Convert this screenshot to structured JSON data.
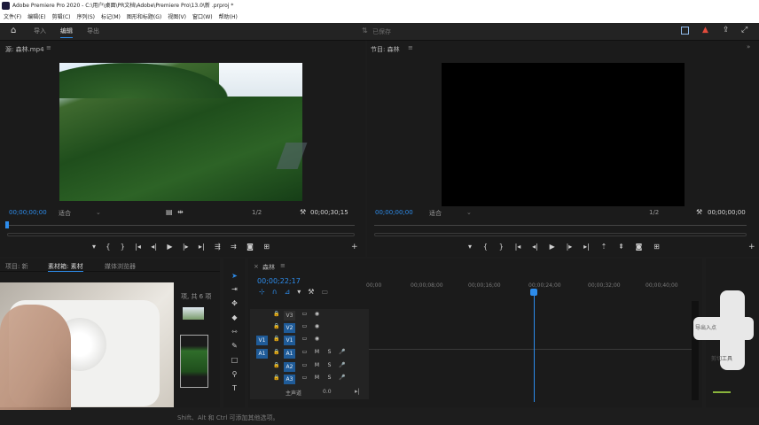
{
  "titlebar": {
    "text": "Adobe Premiere Pro 2020 - C:\\用户\\桌面\\PR文档\\Adobe\\Premiere Pro\\13.0\\新 .prproj *"
  },
  "menus": [
    "文件(F)",
    "编辑(E)",
    "剪辑(C)",
    "序列(S)",
    "标记(M)",
    "图形和标题(G)",
    "视图(V)",
    "窗口(W)",
    "帮助(H)"
  ],
  "workspace_tabs": [
    {
      "label": "导入"
    },
    {
      "label": "编辑",
      "active": true
    },
    {
      "label": "导出"
    }
  ],
  "center_status": "已保存",
  "source_monitor": {
    "title": "源: 森林.mp4",
    "timecode_left": "00;00;00;00",
    "fit": "适合",
    "resolution": "1/2",
    "timecode_right": "00;00;30;15"
  },
  "program_monitor": {
    "title": "节目: 森林",
    "timecode_left": "00;00;00;00",
    "fit": "适合",
    "resolution": "1/2",
    "timecode_right": "00;00;00;00"
  },
  "project_panel": {
    "tabs": [
      "项目: 新",
      "素材箱: 素材",
      "媒体浏览器"
    ],
    "item_count": "项, 共 6 项"
  },
  "timeline": {
    "title": "森林",
    "timecode": "00;00;22;17",
    "ruler_labels": [
      "00;00",
      "00;00;08;00",
      "00;00;16;00",
      "00;00;24;00",
      "00;00;32;00",
      "00;00;40;00"
    ],
    "playhead_fraction": 0.515,
    "video_tracks": [
      "V3",
      "V2",
      "V1"
    ],
    "audio_tracks": [
      "A1",
      "A2",
      "A3"
    ],
    "track_labels": [
      "V3",
      "V2",
      "V1",
      "A1",
      "A2",
      "A3"
    ],
    "source_patch": [
      "V1",
      "A1"
    ],
    "btn_m": "M",
    "btn_s": "S",
    "mix_label": "主声道",
    "mix_value": "0.0"
  },
  "status_bar": "Shift、Alt 和 Ctrl 可添加其他选项。",
  "dial_device": {
    "label_left": "导出入点",
    "label_bottom": "剪切工具"
  }
}
